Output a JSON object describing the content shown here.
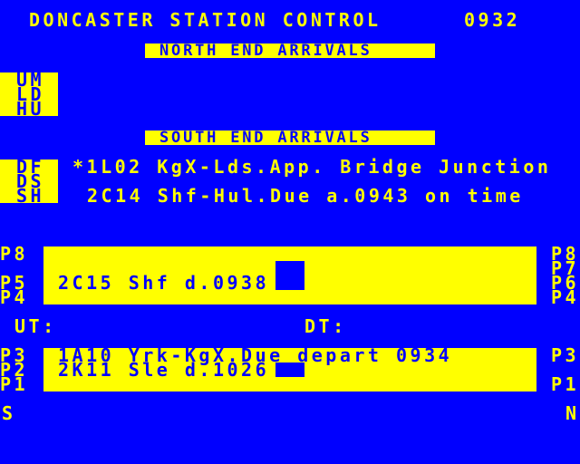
{
  "header": {
    "title": "DONCASTER STATION CONTROL",
    "time": "0932"
  },
  "north": {
    "heading": "NORTH END ARRIVALS",
    "routes": [
      "UM",
      "LD",
      "HU"
    ]
  },
  "south": {
    "heading": "SOUTH END ARRIVALS",
    "routes": [
      "DF",
      "DS",
      "SH"
    ],
    "messages": [
      "*1L02 KgX-Lds.App. Bridge Junction",
      "2C14 Shf-Hul.Due a.0943 on time"
    ]
  },
  "platforms_upper": {
    "left_labels": [
      "P8",
      "P5",
      "P4"
    ],
    "right_labels": [
      "P8",
      "P7",
      "P6",
      "P4"
    ],
    "train": "2C15 Shf d.0938"
  },
  "lines": {
    "up": "UT:",
    "down": "DT:"
  },
  "platforms_lower": {
    "left_labels": [
      "P3",
      "P2",
      "P1"
    ],
    "right_labels": [
      "P3",
      "P1"
    ],
    "train1": "1A10 Yrk-KgX.Due depart 0934",
    "train2": "2K11 Sle d.1026"
  },
  "compass": {
    "south": "S",
    "north": "N"
  },
  "colors": {
    "background": "#0000ff",
    "foreground": "#ffff00"
  }
}
